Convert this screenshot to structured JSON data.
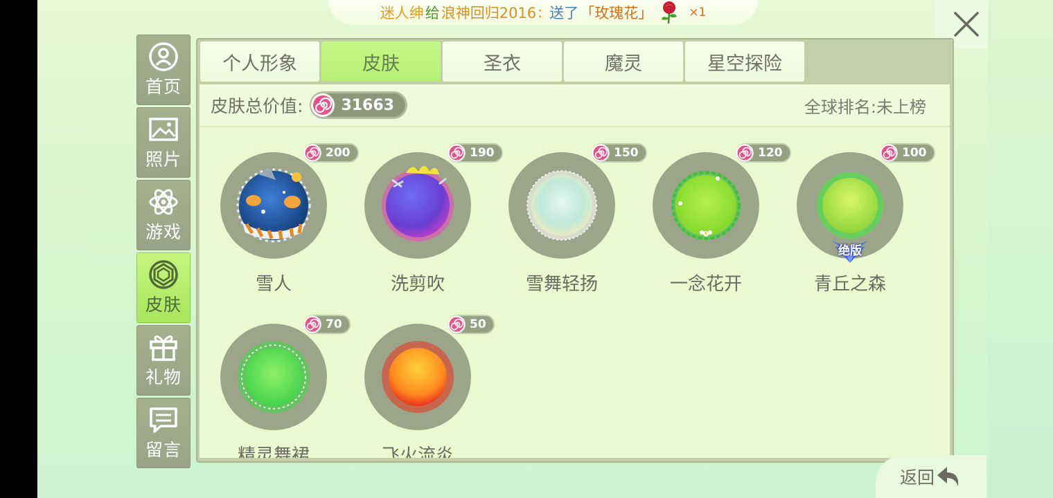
{
  "banner": {
    "sender": "迷人绅",
    "connector": "给",
    "receiver": "浪神回归2016",
    "colon": ":",
    "action": "送了",
    "gift": "「玫瑰花」",
    "count": "×1"
  },
  "nav": [
    {
      "label": "首页",
      "icon": "user-icon",
      "active": false
    },
    {
      "label": "照片",
      "icon": "photo-icon",
      "active": false
    },
    {
      "label": "游戏",
      "icon": "atom-icon",
      "active": false
    },
    {
      "label": "皮肤",
      "icon": "diamond-icon",
      "active": true
    },
    {
      "label": "礼物",
      "icon": "gift-icon",
      "active": false
    },
    {
      "label": "留言",
      "icon": "message-icon",
      "active": false
    }
  ],
  "tabs": [
    {
      "label": "个人形象",
      "active": false
    },
    {
      "label": "皮肤",
      "active": true
    },
    {
      "label": "圣衣",
      "active": false
    },
    {
      "label": "魔灵",
      "active": false
    },
    {
      "label": "星空探险",
      "active": false
    }
  ],
  "summary": {
    "label": "皮肤总价值:",
    "value": "31663",
    "rank": "全球排名:未上榜"
  },
  "skins": [
    {
      "name": "雪人",
      "price": "200"
    },
    {
      "name": "洗剪吹",
      "price": "190"
    },
    {
      "name": "雪舞轻扬",
      "price": "150"
    },
    {
      "name": "一念花开",
      "price": "120"
    },
    {
      "name": "青丘之森",
      "price": "100",
      "badge": "绝版"
    },
    {
      "name": "精灵舞裙",
      "price": "70"
    },
    {
      "name": "飞火流炎",
      "price": "50"
    }
  ],
  "back_label": "返回",
  "colors": {
    "active_tab": "#b9f07a",
    "panel": "#eaf9d0",
    "candy_pink": "#e8477a"
  }
}
